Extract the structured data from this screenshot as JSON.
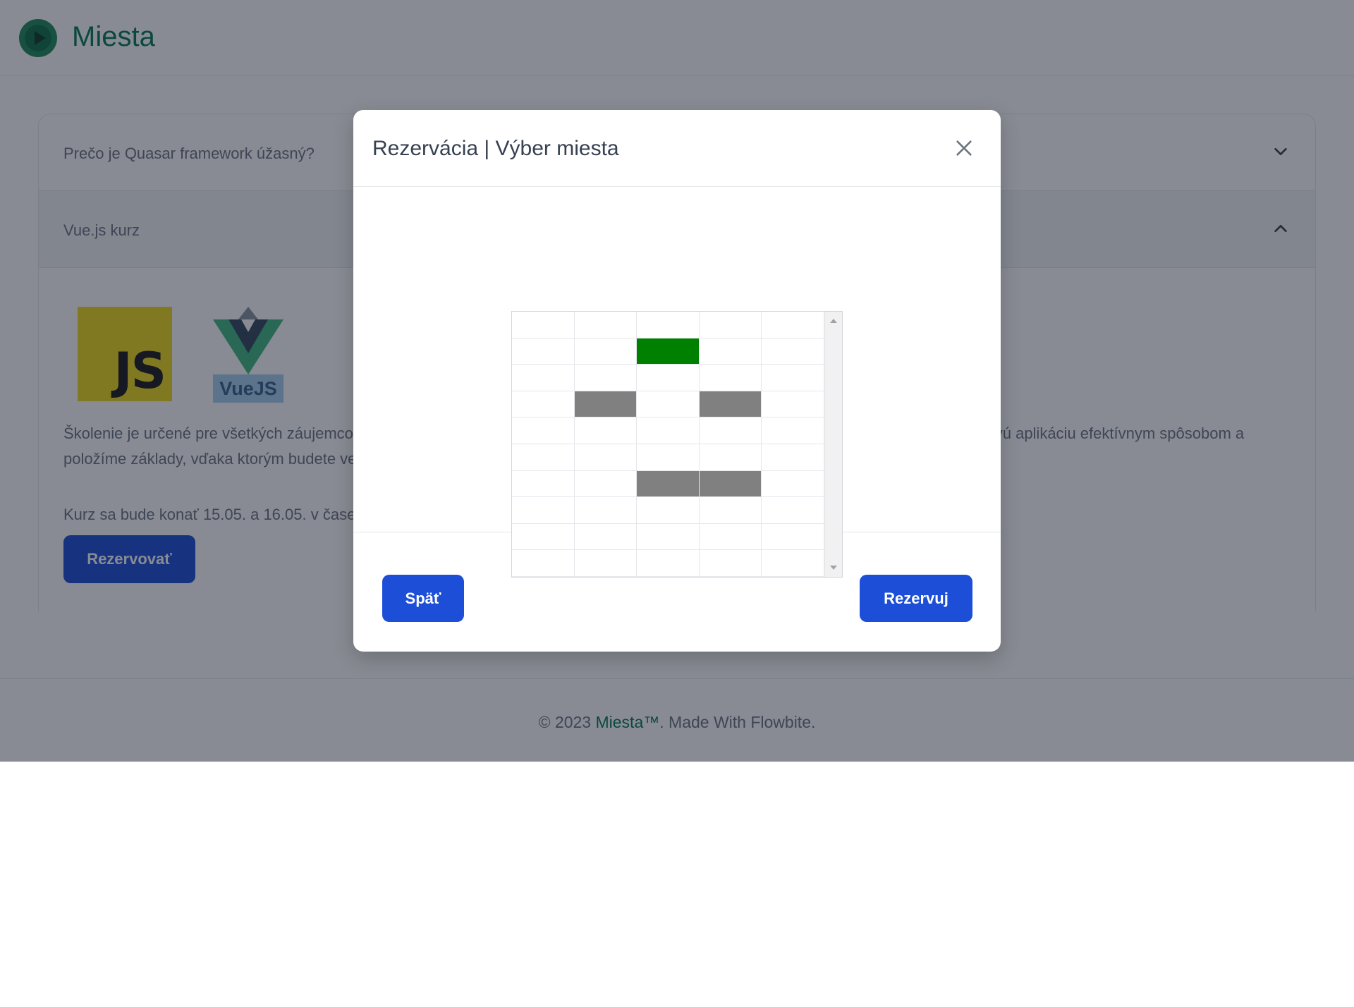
{
  "navbar": {
    "brand": "Miesta",
    "logo_icon": "play-circle-icon"
  },
  "accordion": {
    "items": [
      {
        "title": "Prečo je Quasar framework úžasný?",
        "chevron": "chevron-down-icon",
        "expanded": false
      },
      {
        "title": "Vue.js kurz",
        "chevron": "chevron-up-icon",
        "expanded": true
      }
    ],
    "course": {
      "js_logo_text": "JS",
      "vue_logo_text": "VueJS",
      "description": "Školenie je určené pre všetkých záujemcov o programovanie webových aplikácií pomocou Vue.js. Naučíme vás vytvoriť si vlastnú webovú aplikáciu efektívnym spôsobom a položíme základy, vďaka ktorým budete vedieť vytvárať moderné aplikácia rýchlejšie ako so staršími postupmi tvorby webov.",
      "date_text": "Kurz sa bude konať 15.05. a 16.05. v čase",
      "reserve_label": "Rezervovať"
    }
  },
  "footer": {
    "prefix": "© 2023 ",
    "brand": "Miesta™",
    "suffix": ". Made With Flowbite."
  },
  "modal": {
    "title": "Rezervácia | Výber miesta",
    "close_icon": "close-icon",
    "back_label": "Späť",
    "reserve_label": "Rezervuj",
    "seat_grid": {
      "rows": 10,
      "cols": 5,
      "legend_colors": {
        "free": "#ffffff",
        "selected": "#008000",
        "taken": "#808080"
      },
      "seats": [
        [
          "free",
          "free",
          "free",
          "free",
          "free"
        ],
        [
          "free",
          "free",
          "selected",
          "free",
          "free"
        ],
        [
          "free",
          "free",
          "free",
          "free",
          "free"
        ],
        [
          "free",
          "taken",
          "free",
          "taken",
          "free"
        ],
        [
          "free",
          "free",
          "free",
          "free",
          "free"
        ],
        [
          "free",
          "free",
          "free",
          "free",
          "free"
        ],
        [
          "free",
          "free",
          "taken",
          "taken",
          "free"
        ],
        [
          "free",
          "free",
          "free",
          "free",
          "free"
        ],
        [
          "free",
          "free",
          "free",
          "free",
          "free"
        ],
        [
          "free",
          "free",
          "free",
          "free",
          "free"
        ]
      ]
    }
  },
  "colors": {
    "brand": "#047857",
    "primary_button": "#1d4ed8",
    "overlay": "rgba(17,24,39,0.5)"
  }
}
